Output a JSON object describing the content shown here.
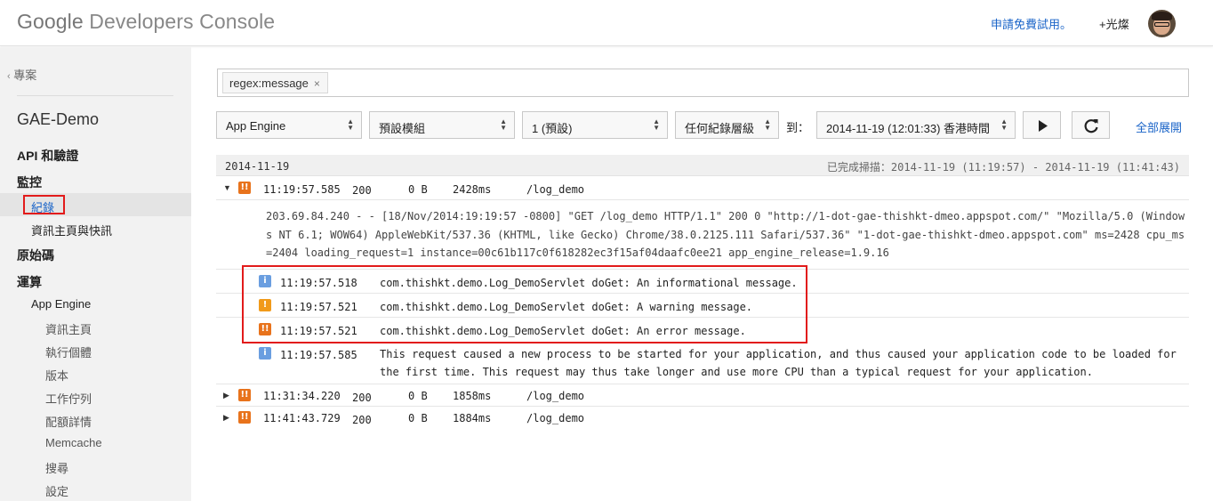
{
  "header": {
    "logo_google": "Google",
    "logo_product": "Developers Console",
    "trial_link": "申請免費試用。",
    "user_name": "+光燦",
    "avatar_icon": "user-avatar"
  },
  "sidebar": {
    "back_label": "專案",
    "project_name": "GAE-Demo",
    "api_auth": "API 和驗證",
    "monitoring": "監控",
    "logs": "紀錄",
    "dashboard": "資訊主頁與快訊",
    "source": "原始碼",
    "compute": "運算",
    "app_engine": "App Engine",
    "sub": [
      "資訊主頁",
      "執行個體",
      "版本",
      "工作佇列",
      "配額詳情",
      "Memcache",
      "搜尋",
      "設定"
    ]
  },
  "filter": {
    "chip_label": "regex:message",
    "chip_close": "×"
  },
  "controls": {
    "service": "App Engine",
    "module": "預設模組",
    "version": "1 (預設)",
    "level": "任何紀錄層級",
    "to_label": "到：",
    "datetime": "2014-11-19 (12:01:33) 香港時間",
    "play_icon": "play-icon",
    "refresh_icon": "refresh-icon",
    "expand_all": "全部展開"
  },
  "date_bar": {
    "date": "2014-11-19",
    "scan_status": "已完成掃描：2014-11-19 (11:19:57) - 2014-11-19 (11:41:43)"
  },
  "entries": [
    {
      "time": "11:19:57.585",
      "status": "200",
      "size": "0 B",
      "latency": "2428ms",
      "path": "/log_demo",
      "expanded": true
    },
    {
      "time": "11:31:34.220",
      "status": "200",
      "size": "0 B",
      "latency": "1858ms",
      "path": "/log_demo",
      "expanded": false
    },
    {
      "time": "11:41:43.729",
      "status": "200",
      "size": "0 B",
      "latency": "1884ms",
      "path": "/log_demo",
      "expanded": false
    }
  ],
  "detail_text": "203.69.84.240 - - [18/Nov/2014:19:19:57 -0800] \"GET /log_demo HTTP/1.1\" 200 0 \"http://1-dot-gae-thishkt-dmeo.appspot.com/\" \"Mozilla/5.0 (Windows NT 6.1; WOW64) AppleWebKit/537.36 (KHTML, like Gecko) Chrome/38.0.2125.111 Safari/537.36\" \"1-dot-gae-thishkt-dmeo.appspot.com\" ms=2428 cpu_ms=2404 loading_request=1 instance=00c61b117c0f618282ec3f15af04daafc0ee21 app_engine_release=1.9.16",
  "app_logs": [
    {
      "severity": "info",
      "icon": "i",
      "time": "11:19:57.518",
      "message": "com.thishkt.demo.Log_DemoServlet doGet: An informational message."
    },
    {
      "severity": "warning",
      "icon": "!",
      "time": "11:19:57.521",
      "message": "com.thishkt.demo.Log_DemoServlet doGet: A warning message."
    },
    {
      "severity": "error",
      "icon": "!!",
      "time": "11:19:57.521",
      "message": "com.thishkt.demo.Log_DemoServlet doGet: An error message."
    },
    {
      "severity": "info",
      "icon": "i",
      "time": "11:19:57.585",
      "message": "This request caused a new process to be started for your application, and thus caused your application code to be loaded for the first time. This request may thus take longer and use more CPU than a typical request for your application."
    }
  ],
  "colors": {
    "accent_link": "#1a64c8",
    "highlight_red": "#e21b1b",
    "error_orange": "#e8731c",
    "warning_orange": "#f19a1a",
    "info_blue": "#6a9ee0"
  }
}
